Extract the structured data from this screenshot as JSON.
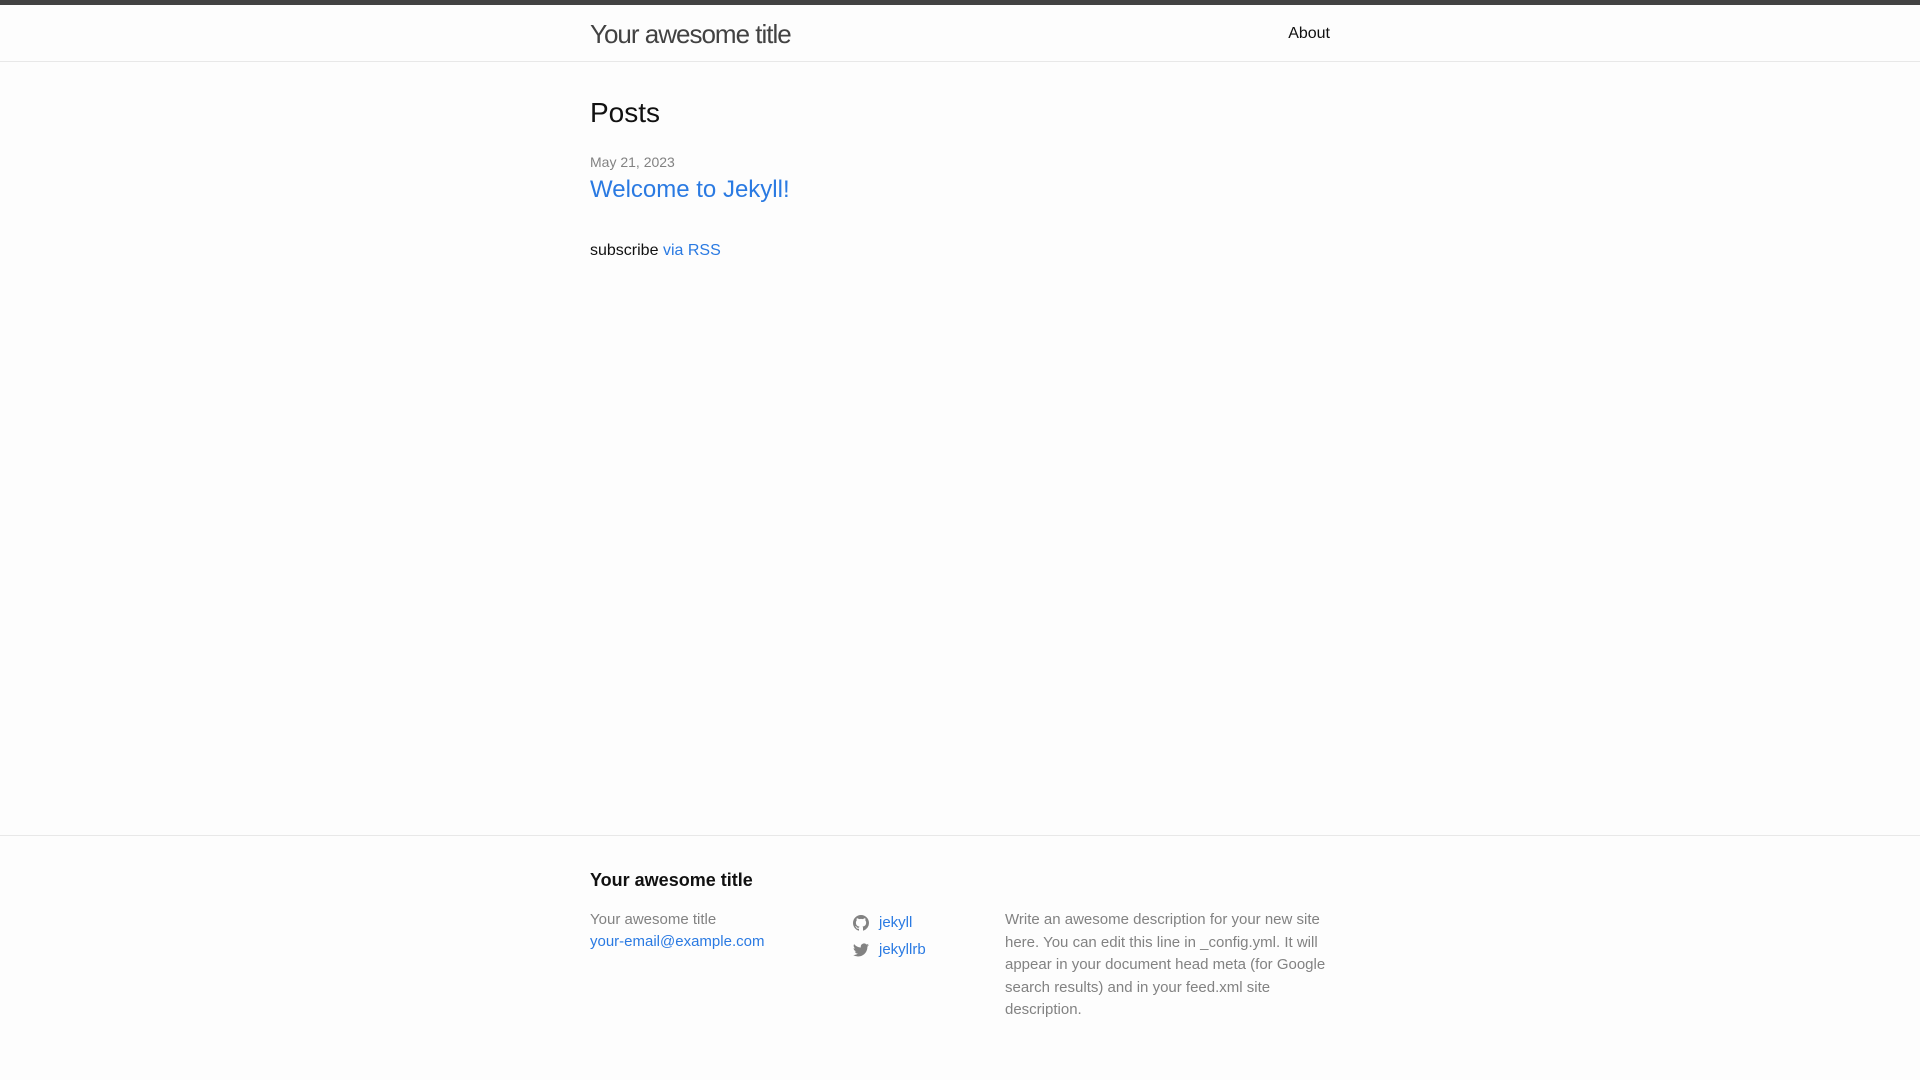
{
  "header": {
    "site_title": "Your awesome title",
    "nav": [
      {
        "label": "About"
      }
    ]
  },
  "main": {
    "heading": "Posts",
    "posts": [
      {
        "date": "May 21, 2023",
        "title": "Welcome to Jekyll!"
      }
    ],
    "rss": {
      "prefix": "subscribe",
      "link_label": "via RSS"
    }
  },
  "footer": {
    "heading": "Your awesome title",
    "contact": {
      "name": "Your awesome title",
      "email": "your-email@example.com"
    },
    "social": [
      {
        "icon": "github-icon",
        "label": "jekyll"
      },
      {
        "icon": "twitter-icon",
        "label": "jekyllrb"
      }
    ],
    "description": "Write an awesome description for your new site here. You can edit this line in _config.yml. It will appear in your document head meta (for Google search results) and in your feed.xml site description."
  },
  "colors": {
    "link": "#2a7ae2",
    "text": "#111111",
    "muted": "#828282",
    "header_border_top": "#424242",
    "divider": "#e8e8e8",
    "background": "#fdfdfd"
  }
}
